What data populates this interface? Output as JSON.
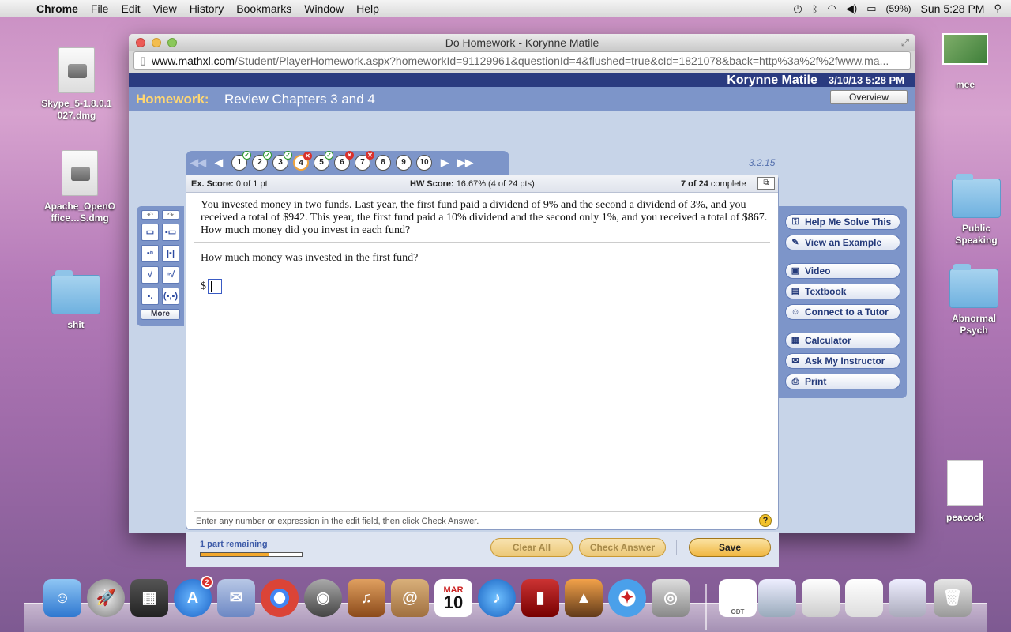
{
  "menubar": {
    "app": "Chrome",
    "items": [
      "File",
      "Edit",
      "View",
      "History",
      "Bookmarks",
      "Window",
      "Help"
    ],
    "battery": "(59%)",
    "clock": "Sun 5:28 PM"
  },
  "desktop": {
    "skype": "Skype_5-1.8.0.1027.dmg",
    "apache": "Apache_OpenOffice…S.dmg",
    "shit_folder": "shit",
    "mee": "mee",
    "public_speaking": "Public Speaking",
    "abnormal_psych": "Abnormal Psych",
    "peacock": "peacock"
  },
  "window": {
    "title": "Do Homework - Korynne Matile",
    "url_host": "www.mathxl.com",
    "url_path": "/Student/PlayerHomework.aspx?homeworkId=91129961&questionId=4&flushed=true&cId=1821078&back=http%3a%2f%2fwww.ma..."
  },
  "user": {
    "name": "Korynne Matile",
    "datetime": "3/10/13 5:28 PM"
  },
  "homework": {
    "label": "Homework:",
    "title": "Review Chapters 3 and 4",
    "overview": "Overview",
    "section": "3.2.15"
  },
  "questions": [
    {
      "num": "1",
      "status": "correct"
    },
    {
      "num": "2",
      "status": "correct"
    },
    {
      "num": "3",
      "status": "correct"
    },
    {
      "num": "4",
      "status": "wrong"
    },
    {
      "num": "5",
      "status": "correct"
    },
    {
      "num": "6",
      "status": "wrong"
    },
    {
      "num": "7",
      "status": "wrong"
    },
    {
      "num": "8",
      "status": "none"
    },
    {
      "num": "9",
      "status": "none"
    },
    {
      "num": "10",
      "status": "none"
    }
  ],
  "score": {
    "ex_label": "Ex. Score:",
    "ex_value": "0 of 1 pt",
    "hw_label": "HW Score:",
    "hw_value": "16.67% (4 of 24 pts)",
    "complete_count": "7 of 24",
    "complete_label": "complete"
  },
  "question": {
    "text": "You invested money in two funds. Last year, the first fund paid a dividend of 9% and the second a dividend of 3%, and you received a total of $942. This year, the first fund paid a 10% dividend and the second only 1%, and you received a total of $867. How much money did you invest in each fund?",
    "sub": "How much money was invested in the first fund?",
    "prefix": "$",
    "hint": "Enter any number or expression in the edit field, then click Check Answer."
  },
  "toolbox": {
    "more": "More"
  },
  "sidebar": {
    "help_solve": "Help Me Solve This",
    "example": "View an Example",
    "video": "Video",
    "textbook": "Textbook",
    "tutor": "Connect to a Tutor",
    "calculator": "Calculator",
    "instructor": "Ask My Instructor",
    "print": "Print"
  },
  "footer": {
    "remaining": "1 part remaining",
    "progress_fraction": 0.68,
    "clear": "Clear All",
    "check": "Check Answer",
    "save": "Save"
  },
  "dock": {
    "appstore_badge": "2",
    "calendar_month": "MAR",
    "calendar_day": "10",
    "odt_label": "ODT"
  }
}
